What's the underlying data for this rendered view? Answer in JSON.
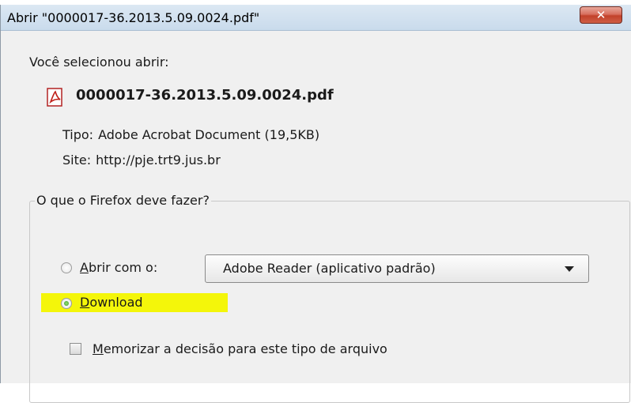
{
  "dialog": {
    "title": "Abrir \"0000017-36.2013.5.09.0024.pdf\"",
    "close_glyph": "✕",
    "selected_label": "Você selecionou abrir:",
    "file": {
      "icon": "pdf-file-icon",
      "name": "0000017-36.2013.5.09.0024.pdf",
      "type_key": "Tipo:",
      "type_value": "Adobe Acrobat Document (19,5KB)",
      "site_key": "Site:",
      "site_value": "http://pje.trt9.jus.br"
    },
    "action_group": {
      "legend": "O que o Firefox deve fazer?",
      "open_with": {
        "mnemonic": "A",
        "rest": "brir com o:",
        "selected": false
      },
      "app_select": {
        "value": "Adobe Reader  (aplicativo padrão)"
      },
      "download": {
        "mnemonic": "D",
        "rest": "ownload",
        "selected": true
      },
      "remember": {
        "mnemonic": "M",
        "rest": "emorizar a decisão para este tipo de arquivo",
        "checked": false
      }
    },
    "colors": {
      "highlight": "#f4f60a",
      "close_button": "#c2412b",
      "radio_selected": "#2f9a1b"
    }
  }
}
